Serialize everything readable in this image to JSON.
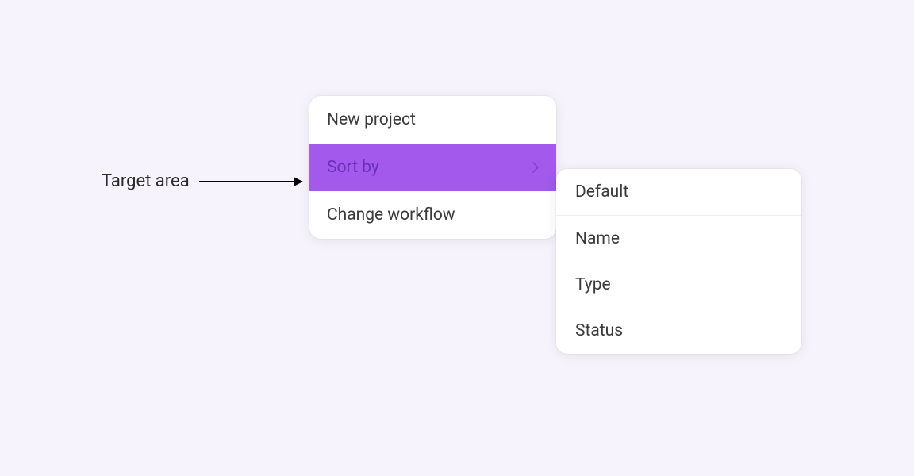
{
  "annotation": {
    "label": "Target area"
  },
  "primaryMenu": {
    "items": [
      {
        "label": "New project",
        "highlighted": false,
        "hasSubmenu": false
      },
      {
        "label": "Sort by",
        "highlighted": true,
        "hasSubmenu": true
      },
      {
        "label": "Change workflow",
        "highlighted": false,
        "hasSubmenu": false
      }
    ]
  },
  "submenu": {
    "items": [
      {
        "label": "Default"
      },
      {
        "label": "Name"
      },
      {
        "label": "Type"
      },
      {
        "label": "Status"
      }
    ]
  }
}
